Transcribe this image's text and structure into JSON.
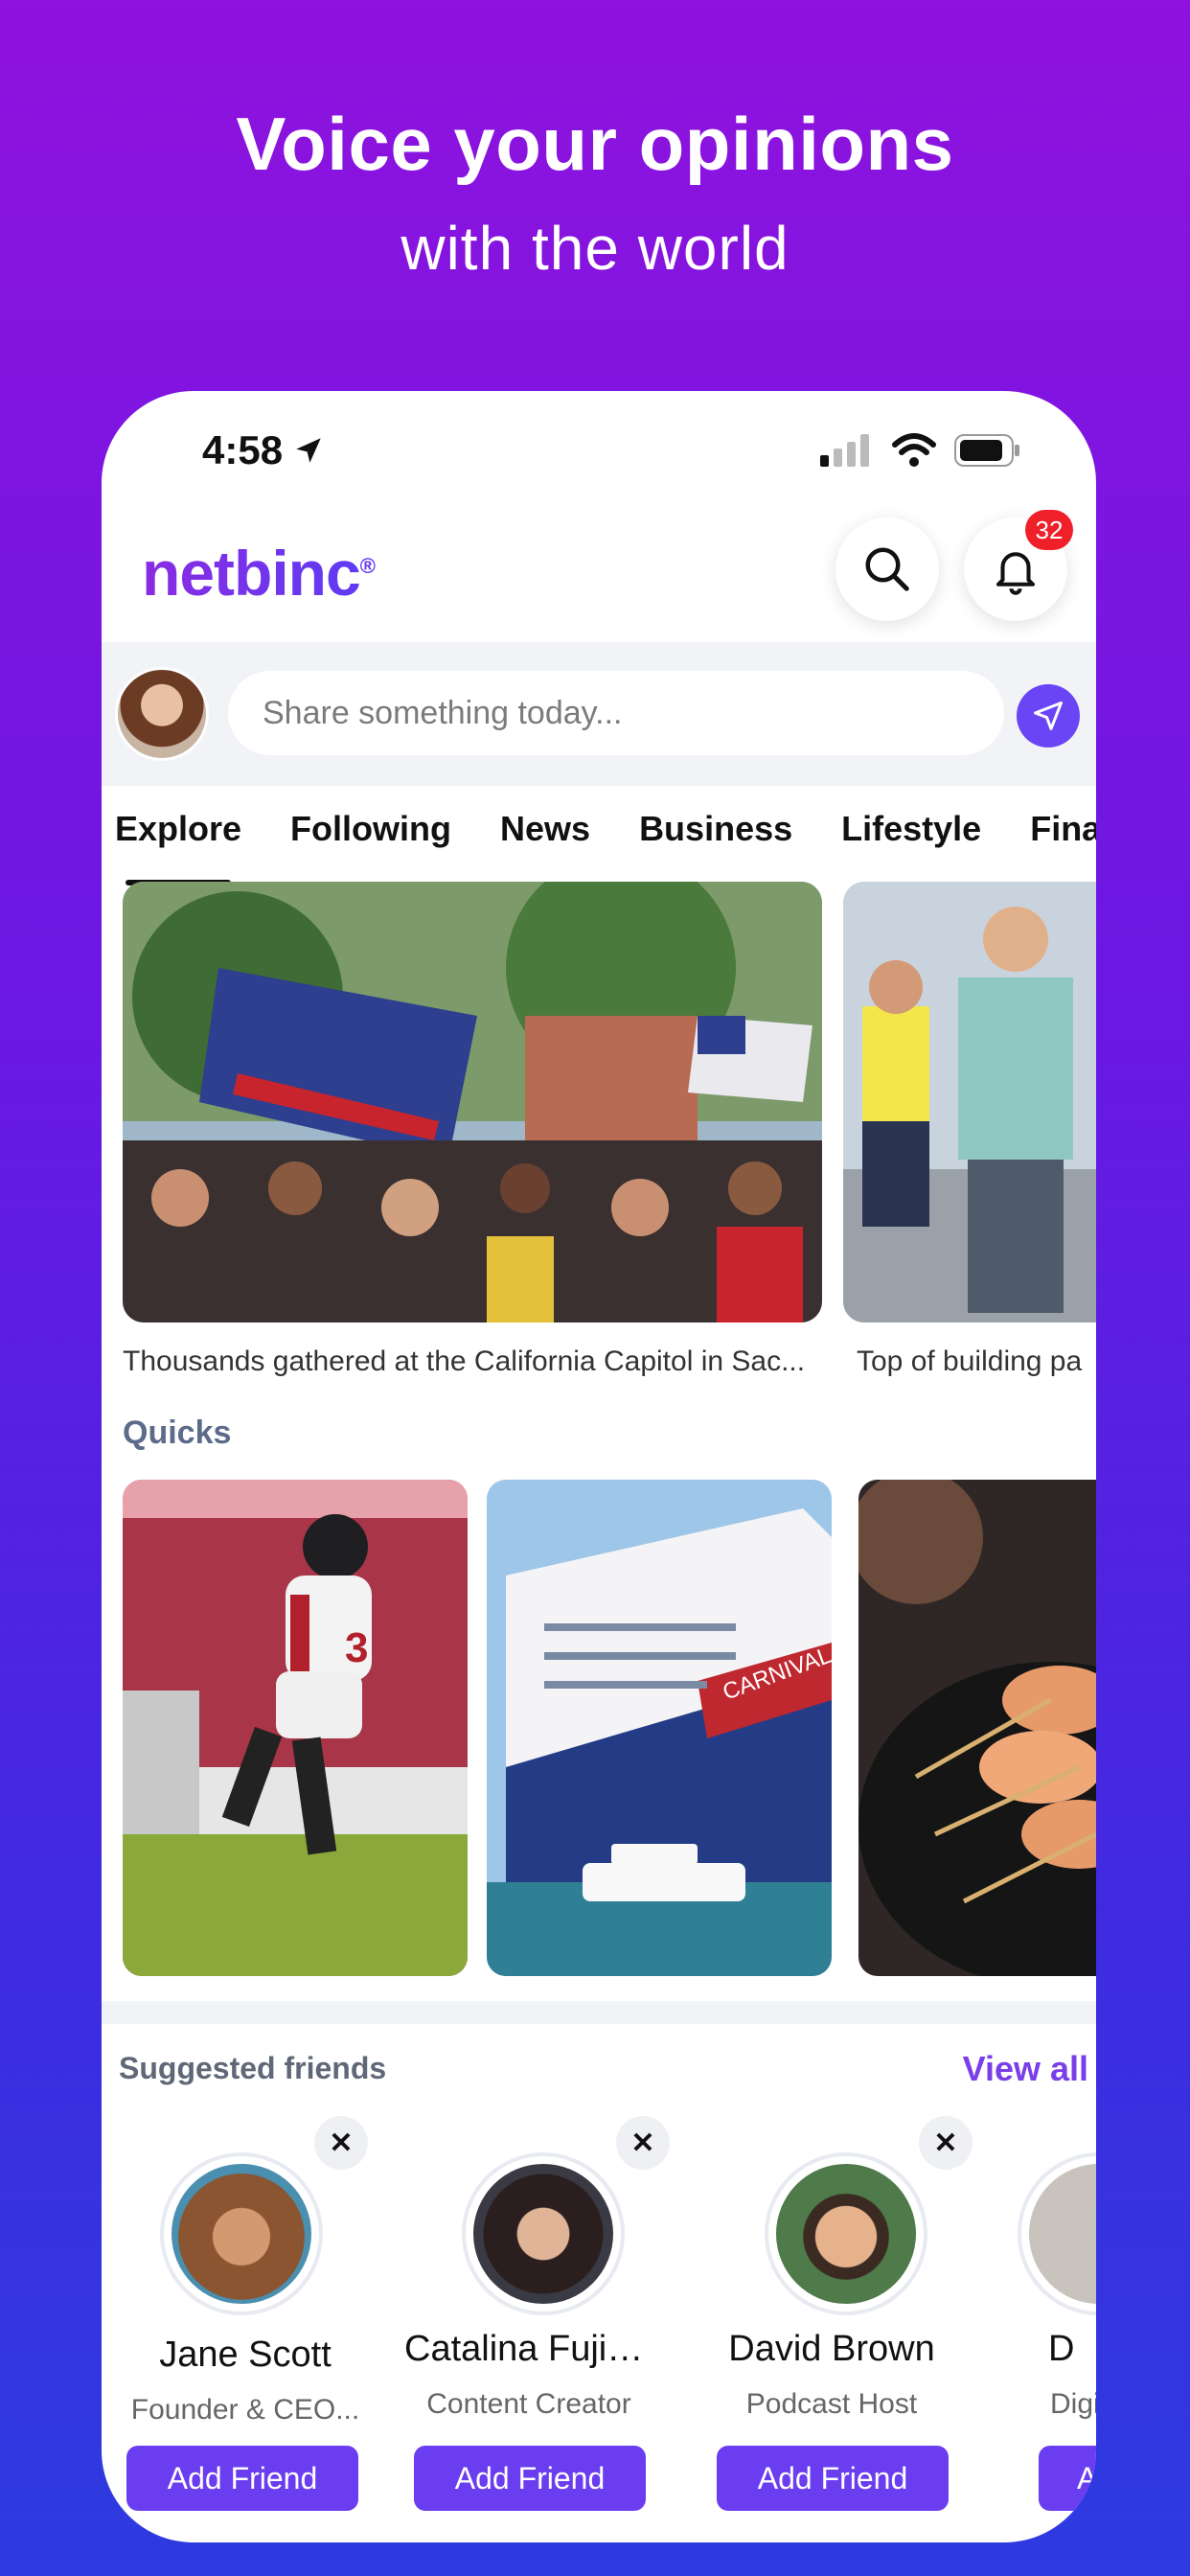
{
  "promo": {
    "title": "Voice your opinions",
    "subtitle": "with the world"
  },
  "status_bar": {
    "time": "4:58"
  },
  "header": {
    "logo": "netbinc",
    "logo_mark": "®",
    "notification_count": "32"
  },
  "composer": {
    "placeholder": "Share something today..."
  },
  "tabs": [
    {
      "label": "Explore",
      "active": true
    },
    {
      "label": "Following"
    },
    {
      "label": "News"
    },
    {
      "label": "Business"
    },
    {
      "label": "Lifestyle"
    },
    {
      "label": "Financ"
    }
  ],
  "feed": [
    {
      "caption": "Thousands gathered at the California Capitol in Sac..."
    },
    {
      "caption": "Top of building pa"
    }
  ],
  "quicks": {
    "title": "Quicks"
  },
  "suggested": {
    "title": "Suggested friends",
    "view_all": "View all",
    "friends": [
      {
        "name": "Jane Scott",
        "role": "Founder & CEO...",
        "button": "Add Friend"
      },
      {
        "name": "Catalina Fujim...",
        "role": "Content Creator",
        "button": "Add Friend"
      },
      {
        "name": "David Brown",
        "role": "Podcast Host",
        "button": "Add Friend"
      },
      {
        "name": "D",
        "role": "Digi",
        "button": "A"
      }
    ]
  },
  "colors": {
    "accent": "#6a3df0",
    "badge": "#f0202a",
    "section_title": "#5c6b8a"
  }
}
